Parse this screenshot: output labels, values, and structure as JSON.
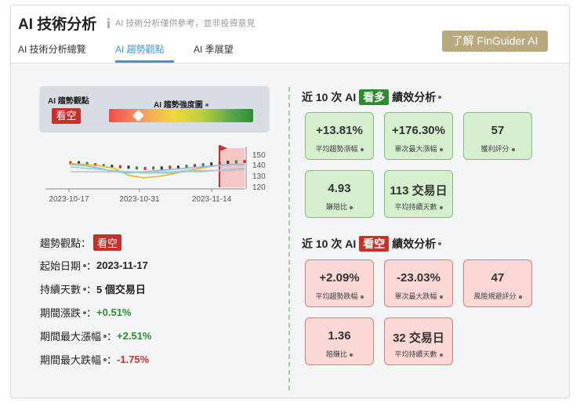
{
  "header": {
    "title": "AI 技術分析",
    "disclaimer": "AI 技術分析僅供參考，並非投資意見",
    "tabs": [
      {
        "label": "AI 技術分析總覽",
        "active": false
      },
      {
        "label": "AI 趨勢觀點",
        "active": true
      },
      {
        "label": "AI 季展望",
        "active": false
      }
    ],
    "cta_label": "了解 FinGuider AI",
    "accent_color": "#3a9ad9",
    "cta_color": "#b8a97e"
  },
  "gauge": {
    "title": "AI 趨勢觀點",
    "badge": "看空",
    "bar_label": "AI 趨勢強度圖",
    "marker_position": 0.2
  },
  "chart_data": {
    "type": "line",
    "x_ticks": [
      "2023-10-17",
      "2023-10-31",
      "2023-11-14"
    ],
    "y_ticks": [
      "150",
      "140",
      "130",
      "120"
    ],
    "ylim": [
      118,
      152
    ],
    "series": [
      {
        "values": [
          138,
          137,
          136,
          134,
          128,
          126,
          127,
          129,
          132,
          134,
          136,
          137,
          137
        ]
      },
      {
        "values": [
          137,
          136,
          134,
          131,
          130,
          131,
          132,
          133,
          134,
          135,
          136,
          137,
          137
        ]
      },
      {
        "values": [
          135,
          134,
          133,
          132,
          131,
          130,
          130,
          130,
          131,
          131,
          132,
          133,
          134
        ]
      },
      {
        "values": [
          131,
          131,
          131,
          131,
          131,
          131,
          131,
          131,
          132,
          132,
          132,
          132,
          133
        ]
      }
    ],
    "candles_count": 22,
    "highlight_zone": "last-5-days"
  },
  "summary": {
    "trend_label": "趨勢觀點",
    "trend_value": "看空",
    "start_label": "起始日期",
    "start_value": "2023-11-17",
    "days_label": "持續天數",
    "days_value": "5 個交易日",
    "change_label": "期間漲跌",
    "change_value": "+0.51%",
    "max_up_label": "期間最大漲幅",
    "max_up_value": "+2.51%",
    "max_down_label": "期間最大跌幅",
    "max_down_value": "-1.75%"
  },
  "bull": {
    "title_prefix": "近 10 次 AI",
    "tag": "看多",
    "title_suffix": "績效分析",
    "stats": [
      {
        "value": "+13.81%",
        "label": "平均趨勢漲幅"
      },
      {
        "value": "+176.30%",
        "label": "單次最大漲幅"
      },
      {
        "value": "57",
        "label": "獲利評分"
      },
      {
        "value": "4.93",
        "label": "賺賠比"
      },
      {
        "value": "113 交易日",
        "label": "平均持續天數"
      }
    ]
  },
  "bear": {
    "title_prefix": "近 10 次 AI",
    "tag": "看空",
    "title_suffix": "績效分析",
    "stats": [
      {
        "value": "+2.09%",
        "label": "平均趨勢跌幅"
      },
      {
        "value": "-23.03%",
        "label": "單次最大跌幅"
      },
      {
        "value": "47",
        "label": "風險規避評分"
      },
      {
        "value": "1.36",
        "label": "賠賺比"
      },
      {
        "value": "32 交易日",
        "label": "平均持續天數"
      }
    ]
  }
}
